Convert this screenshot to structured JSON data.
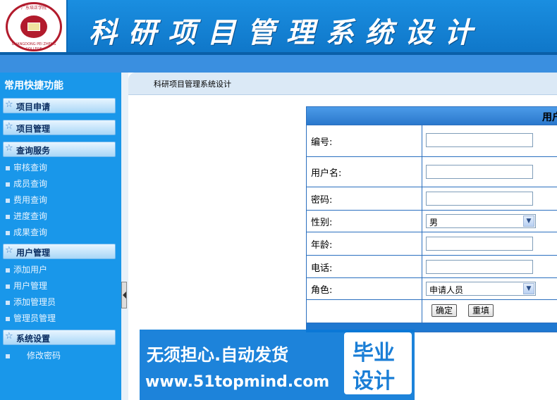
{
  "header": {
    "site_title": "科研项目管理系统设计",
    "logo_ring_top": "广东培正学院",
    "logo_ring_bottom": "GUANGDONG PEI ZHENG COLLEGE"
  },
  "sidebar": {
    "title": "常用快捷功能",
    "sections": [
      {
        "label": "项目申请"
      },
      {
        "label": "项目管理"
      },
      {
        "label": "查询服务",
        "items": [
          "审核查询",
          "成员查询",
          "费用查询",
          "进度查询",
          "成果查询"
        ]
      },
      {
        "label": "用户管理",
        "items": [
          "添加用户",
          "用户管理",
          "添加管理员",
          "管理员管理"
        ]
      },
      {
        "label": "系统设置",
        "items": [
          "修改密码"
        ]
      }
    ]
  },
  "content": {
    "breadcrumb": "科研项目管理系统设计",
    "form": {
      "header": "用户",
      "fields": {
        "id": {
          "label": "编号:",
          "value": ""
        },
        "username": {
          "label": "用户名:",
          "value": ""
        },
        "password": {
          "label": "密码:",
          "value": ""
        },
        "gender": {
          "label": "性别:",
          "selected": "男"
        },
        "age": {
          "label": "年龄:",
          "value": ""
        },
        "phone": {
          "label": "电话:",
          "value": ""
        },
        "role": {
          "label": "角色:",
          "selected": "申请人员"
        }
      },
      "confirm_label": "确定",
      "reset_label": "重填"
    }
  },
  "watermark": {
    "line1": "无须担心.自动发货",
    "line2": "www.51topmind.com",
    "badge_line1": "毕业",
    "badge_line2": "设计"
  }
}
